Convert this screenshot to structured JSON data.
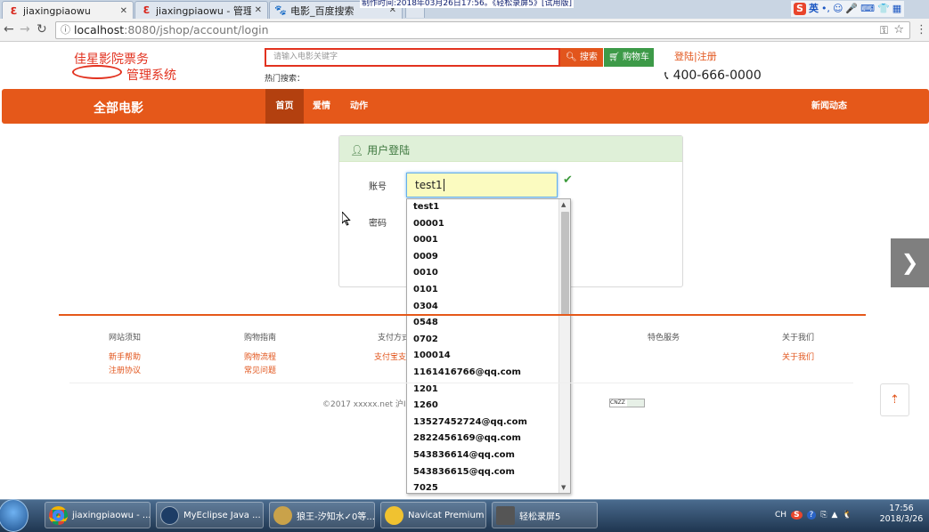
{
  "browser": {
    "tabs": [
      {
        "title": "jiaxingpiaowu",
        "active": true
      },
      {
        "title": "jiaxingpiaowu - 管理系统",
        "active": false
      },
      {
        "title": "电影_百度搜索",
        "active": false
      }
    ],
    "address": {
      "host": "localhost",
      "path": ":8080/jshop/account/login"
    },
    "ime_label": "英"
  },
  "recording_banner": "制作时间:2018年03月26日17:56。《轻松录屏5》[试用版]",
  "header": {
    "logo_line1": "佳星影院票务",
    "logo_line2": "管理系统",
    "search_placeholder": "请输入电影关键字",
    "search_button": "搜索",
    "cart_button": "购物车",
    "hot_search_label": "热门搜索：",
    "login_register": "登陆|注册",
    "phone": "400-666-0000"
  },
  "nav": {
    "brand": "全部电影",
    "items": [
      "首页",
      "爱情",
      "动作"
    ],
    "news": "新闻动态"
  },
  "login": {
    "title": "用户登陆",
    "account_label": "账号",
    "password_label": "密码",
    "account_value": "test1"
  },
  "autocomplete": {
    "items": [
      "test1",
      "00001",
      "0001",
      "0009",
      "0010",
      "0101",
      "0304",
      "0548",
      "0702",
      "100014",
      "1161416766@qq.com",
      "1201",
      "1260",
      "13527452724@qq.com",
      "2822456169@qq.com",
      "543836614@qq.com",
      "543836615@qq.com",
      "7025"
    ]
  },
  "footer": {
    "columns": [
      {
        "title": "网站须知",
        "links": [
          "新手帮助",
          "注册协议"
        ]
      },
      {
        "title": "购物指南",
        "links": [
          "购物流程",
          "常见问题"
        ]
      },
      {
        "title": "支付方式",
        "links": [
          "支付宝支"
        ]
      },
      {
        "title": "特色服务",
        "links": []
      },
      {
        "title": "关于我们",
        "links": [
          "关于我们"
        ]
      }
    ],
    "copyright": "©2017 xxxxx.net 沪ICP",
    "badge": "CNZZ"
  },
  "taskbar": {
    "items": [
      {
        "label": "jiaxingpiaowu - ..."
      },
      {
        "label": "MyEclipse Java ..."
      },
      {
        "label": "狼王-汐知水✓0等..."
      },
      {
        "label": "Navicat Premium"
      },
      {
        "label": "轻松录屏5"
      }
    ],
    "tray_lang": "CH",
    "clock_time": "17:56",
    "clock_date": "2018/3/26"
  },
  "colors": {
    "accent": "#e5581a",
    "logo_red": "#e2321f",
    "cart_green": "#3d9a48",
    "panel_green": "#dff0d8"
  }
}
